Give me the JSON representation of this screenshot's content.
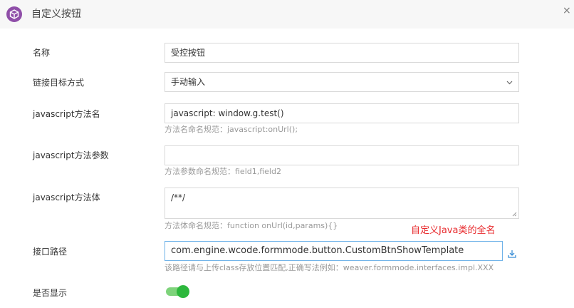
{
  "header": {
    "title": "自定义按钮",
    "close": "×"
  },
  "form": {
    "name": {
      "label": "名称",
      "value": "受控按钮"
    },
    "link_mode": {
      "label": "链接目标方式",
      "value": "手动输入"
    },
    "js_method": {
      "label": "javascript方法名",
      "value": "javascript: window.g.test()",
      "hint": "方法名命名规范：javascript:onUrl();"
    },
    "js_params": {
      "label": "javascript方法参数",
      "value": "",
      "hint": "方法参数命名规范：field1,field2"
    },
    "js_body": {
      "label": "javascript方法体",
      "value": "/**/",
      "hint": "方法体命名规范：function onUrl(id,params){}"
    },
    "interface_path": {
      "label": "接口路径",
      "value": "com.engine.wcode.formmode.button.CustomBtnShowTemplate",
      "hint": "该路径请与上传class存放位置匹配,正确写法例如：weaver.formmode.interfaces.impl.XXX"
    },
    "display": {
      "label": "是否显示",
      "on": true
    }
  },
  "annotation": "自定义Java类的全名",
  "colors": {
    "accent": "#2db83d",
    "annotation": "#e8292c",
    "logo": "#8f4ea8"
  }
}
